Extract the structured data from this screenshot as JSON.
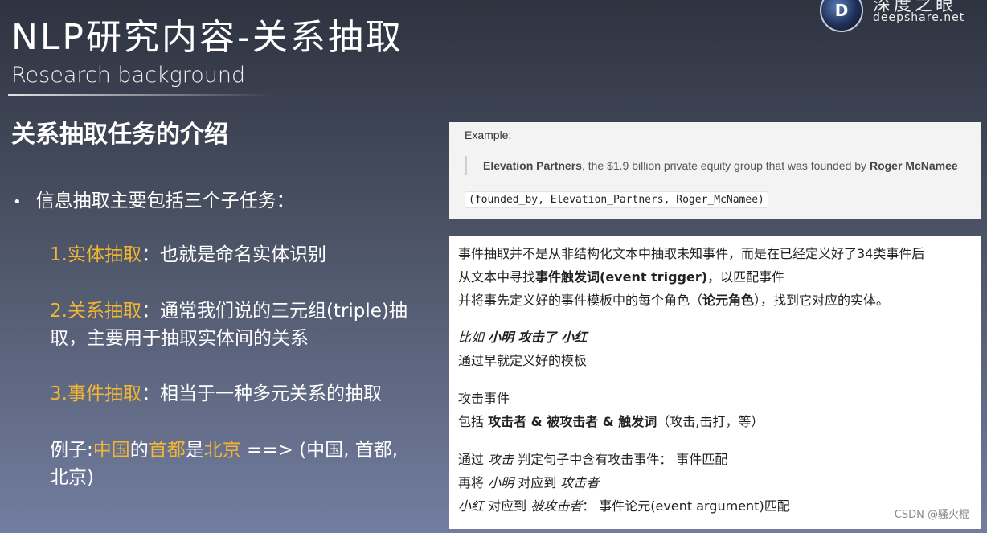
{
  "header": {
    "title": "NLP研究内容-关系抽取",
    "subtitle": "Research background"
  },
  "logo": {
    "letter": "D",
    "cn": "深度之眼",
    "en": "deepshare.net"
  },
  "section": {
    "title": "关系抽取任务的介绍"
  },
  "bullet": {
    "dot": "•",
    "text": "信息抽取主要包括三个子任务："
  },
  "items": [
    {
      "num": "1.",
      "hl": "实体抽取",
      "rest": "：也就是命名实体识别"
    },
    {
      "num": "2.",
      "hl": "关系抽取",
      "rest_line1": "：通常我们说的三元组(triple)抽",
      "rest_line2": "取，主要用于抽取实体间的关系"
    },
    {
      "num": "3.",
      "hl": "事件抽取",
      "rest": "：相当于一种多元关系的抽取"
    }
  ],
  "example_left": {
    "prefix": "例子:",
    "w1": "中国",
    "w2": "的",
    "w3": "首都",
    "w4": "是",
    "w5": "北京",
    "rest_line1": " ==> (中国, 首都,",
    "rest_line2": "北京)"
  },
  "example_box": {
    "label": "Example:",
    "entity1": "Elevation Partners",
    "middle": ", the $1.9 billion private equity group that was founded by ",
    "entity2": "Roger McNamee",
    "code": "(founded_by, Elevation_Partners, Roger_McNamee)"
  },
  "event_box": {
    "l1": "事件抽取并不是从非结构化文本中抽取未知事件，而是在已经定义好了34类事件后",
    "l2a": "从文本中寻找",
    "l2b": "事件触发词(event trigger)",
    "l2c": "，以匹配事件",
    "l3a": "并将事先定义好的事件模板中的每个角色（",
    "l3b": "论元角色",
    "l3c": "），找到它对应的实体。",
    "l4a": "比如 ",
    "l4b": "小明 攻击了 小红",
    "l5": "通过早就定义好的模板",
    "l6": "攻击事件",
    "l7a": "包括 ",
    "l7b": "攻击者 & 被攻击者 & 触发词",
    "l7c": "（攻击,击打，等）",
    "l8a": "通过 ",
    "l8b": "攻击",
    "l8c": " 判定句子中含有攻击事件： 事件匹配",
    "l9a": "再将 ",
    "l9b": "小明",
    "l9c": " 对应到 ",
    "l9d": "攻击者",
    "l10a": "小红",
    "l10b": " 对应到 ",
    "l10c": "被攻击者",
    "l10d": "：  事件论元(event argument)匹配"
  },
  "watermark": "CSDN @骚火棍"
}
